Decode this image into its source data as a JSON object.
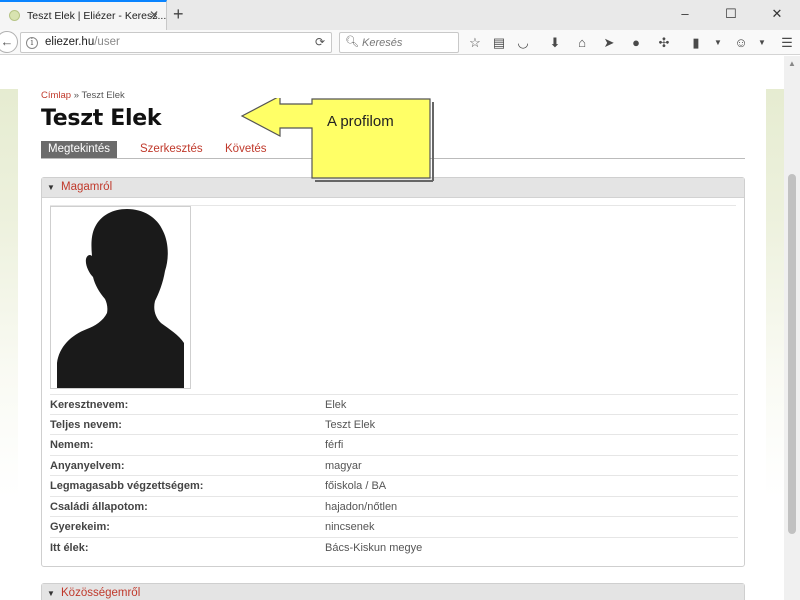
{
  "browser": {
    "tab_title": "Teszt Elek | Eliézer - Keresz...",
    "url_host": "eliezer.hu",
    "url_path": "/user",
    "search_placeholder": "Keresés",
    "window_controls": [
      "–",
      "☐",
      "✕"
    ],
    "toolbar_icons": [
      "star-icon",
      "reading-list-icon",
      "pocket-icon",
      "download-icon",
      "home-icon",
      "send-icon",
      "chat-icon",
      "puzzle-icon",
      "clipboard-icon",
      "avatar-icon",
      "menu-icon"
    ]
  },
  "breadcrumb": {
    "home": "Címlap",
    "separator": "»",
    "current": "Teszt Elek"
  },
  "page": {
    "title": "Teszt Elek"
  },
  "tabs": [
    {
      "label": "Megtekintés",
      "active": true
    },
    {
      "label": "Szerkesztés",
      "active": false
    },
    {
      "label": "Követés",
      "active": false
    }
  ],
  "callout": {
    "text": "A profilom",
    "color": "#ffff66"
  },
  "panels": {
    "about": {
      "title": "Magamról",
      "fields": [
        {
          "label": "Keresztnevem:",
          "value": "Elek"
        },
        {
          "label": "Teljes nevem:",
          "value": "Teszt Elek"
        },
        {
          "label": "Nemem:",
          "value": "férfi"
        },
        {
          "label": "Anyanyelvem:",
          "value": "magyar"
        },
        {
          "label": "Legmagasabb végzettségem:",
          "value": "főiskola / BA"
        },
        {
          "label": "Családi állapotom:",
          "value": "hajadon/nőtlen"
        },
        {
          "label": "Gyerekeim:",
          "value": "nincsenek"
        },
        {
          "label": "Itt élek:",
          "value": "Bács-Kiskun megye"
        }
      ]
    },
    "community": {
      "title": "Közösségemről"
    }
  },
  "colors": {
    "accent": "#c0392b",
    "active_tab": "#6b6b6b",
    "band": "#e6ecd1"
  }
}
